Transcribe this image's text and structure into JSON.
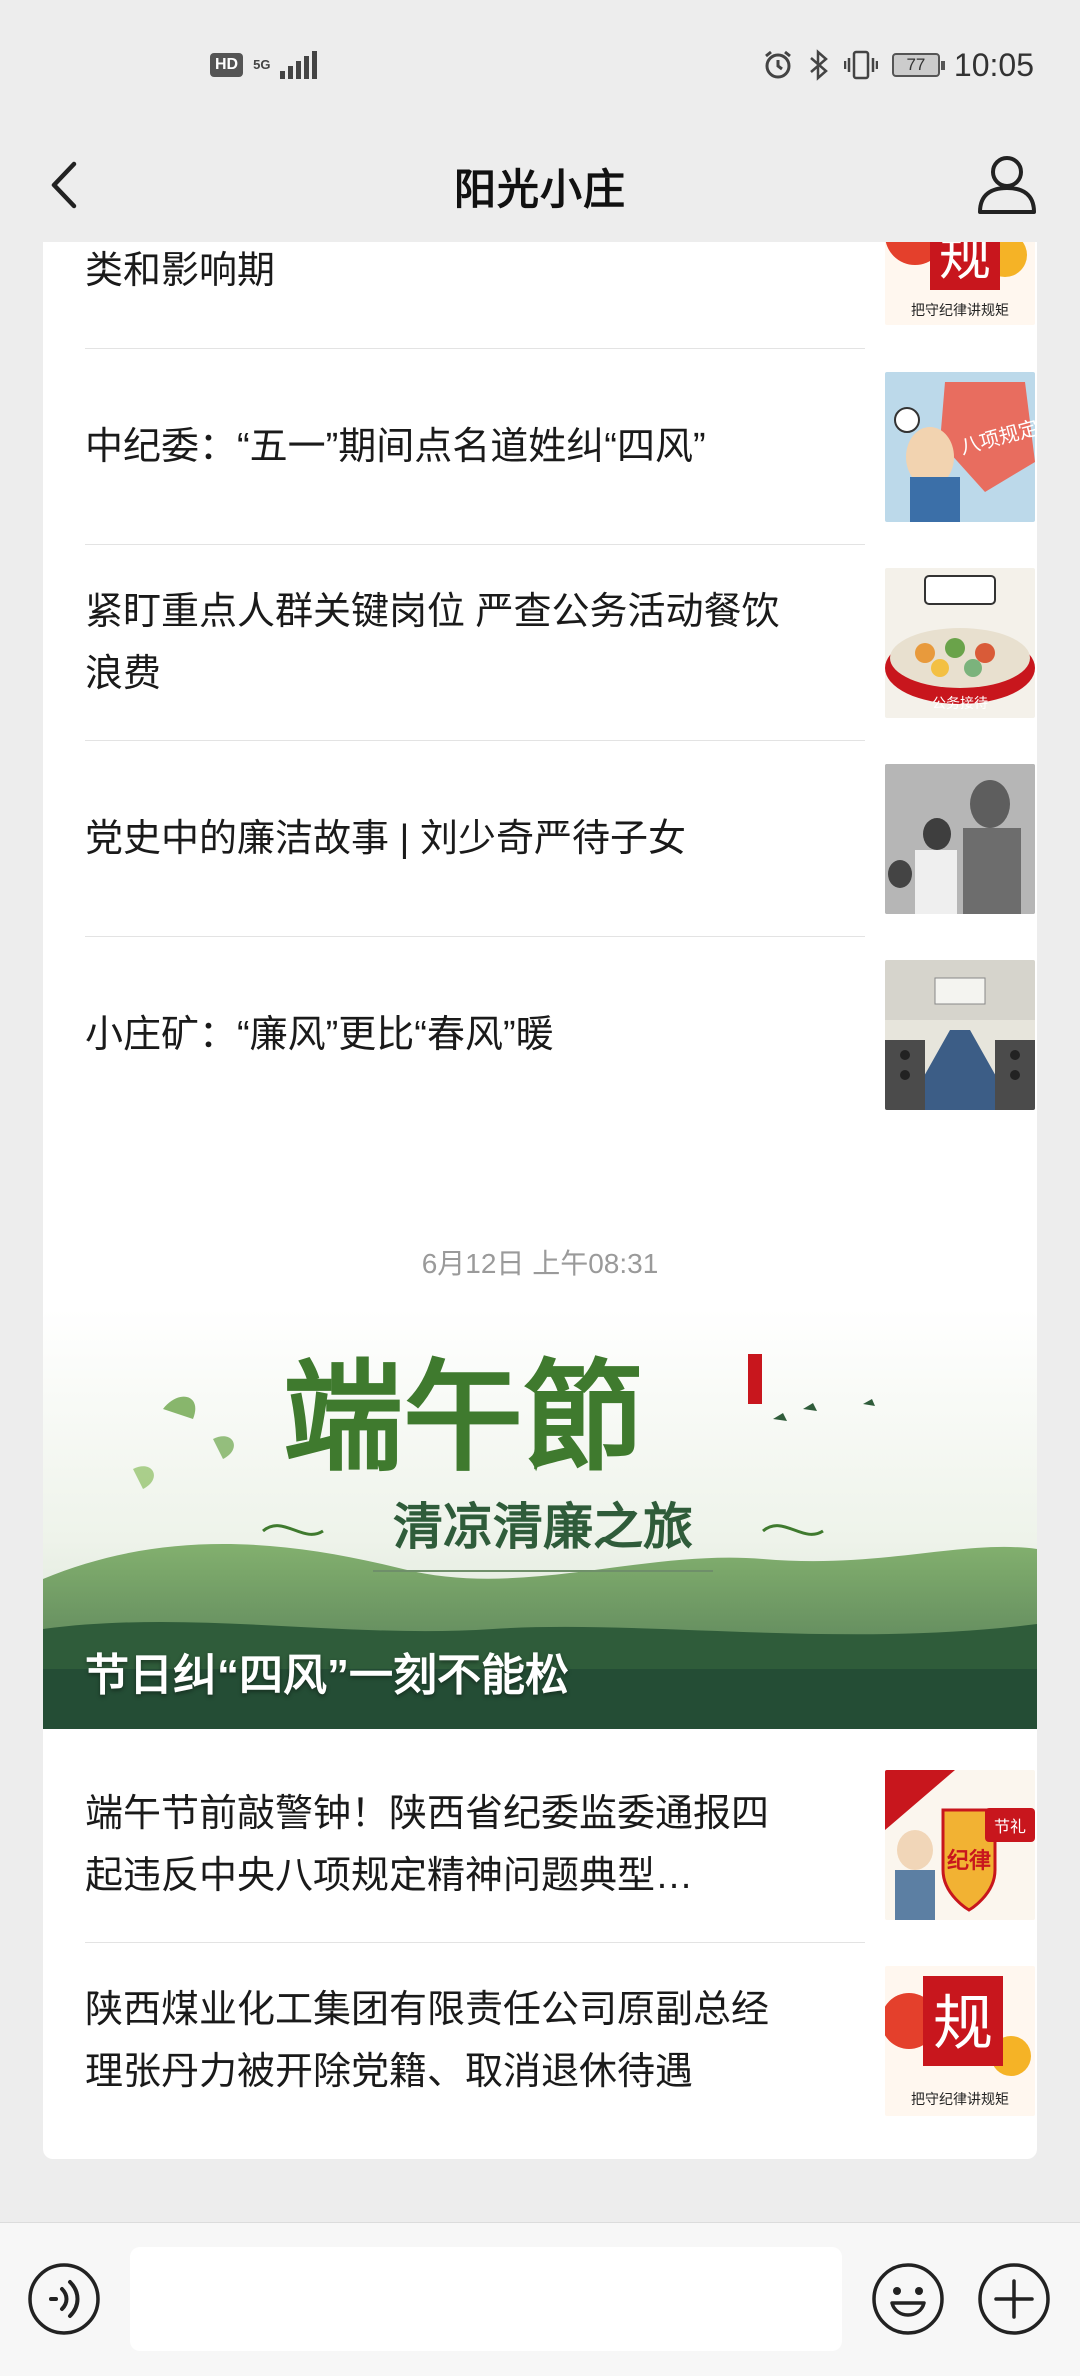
{
  "status_bar": {
    "hd": "HD",
    "network": "5G",
    "battery": "77",
    "time": "10:05",
    "icons": [
      "alarm-icon",
      "bluetooth-icon",
      "vibrate-icon"
    ]
  },
  "header": {
    "title": "阳光小庄",
    "back_icon": "chevron-left-icon",
    "profile_icon": "person-icon"
  },
  "message_card_1": {
    "articles": [
      {
        "title": "类和影响期",
        "thumb_text": "规",
        "thumb_caption": "把守纪律讲规矩"
      },
      {
        "title": "中纪委：“五一”期间点名道姓纠“四风”",
        "thumb_text": "八项规定"
      },
      {
        "title": "紧盯重点人群关键岗位 严查公务活动餐饮浪费",
        "thumb_text": "公务接待"
      },
      {
        "title": "党史中的廉洁故事 | 刘少奇严待子女"
      },
      {
        "title": "小庄矿：“廉风”更比“春风”暖"
      }
    ]
  },
  "timestamp": "6月12日 上午08:31",
  "message_card_2": {
    "banner": {
      "headline": "端午節",
      "subtitle": "清凉清廉之旅",
      "caption": "节日纠“四风”一刻不能松"
    },
    "articles": [
      {
        "title": "端午节前敲警钟！陕西省纪委监委通报四起违反中央八项规定精神问题典型…",
        "thumb_text": "纪律",
        "thumb_badge": "节礼"
      },
      {
        "title": "陕西煤业化工集团有限责任公司原副总经理张丹力被开除党籍、取消退休待遇",
        "thumb_text": "规",
        "thumb_caption": "把守纪律讲规矩"
      }
    ]
  },
  "input_bar": {
    "placeholder": "",
    "voice_icon": "voice-icon",
    "emoji_icon": "emoji-icon",
    "plus_icon": "plus-icon"
  },
  "colors": {
    "background": "#ededed",
    "card": "#ffffff",
    "accent_red": "#c8161d",
    "banner_green": "#3f7a2e"
  }
}
